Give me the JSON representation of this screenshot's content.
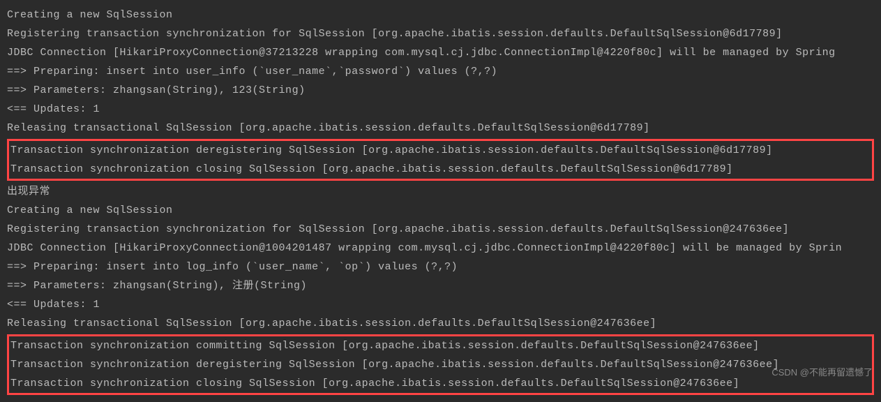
{
  "lines": {
    "l1": "Creating a new SqlSession",
    "l2": "Registering transaction synchronization for SqlSession [org.apache.ibatis.session.defaults.DefaultSqlSession@6d17789]",
    "l3": "JDBC Connection [HikariProxyConnection@37213228 wrapping com.mysql.cj.jdbc.ConnectionImpl@4220f80c] will be managed by Spring",
    "l4": "==>  Preparing: insert into user_info (`user_name`,`password`) values (?,?)",
    "l5": "==> Parameters: zhangsan(String), 123(String)",
    "l6": "<==    Updates: 1",
    "l7": "Releasing transactional SqlSession [org.apache.ibatis.session.defaults.DefaultSqlSession@6d17789]",
    "l8": "Transaction synchronization deregistering SqlSession [org.apache.ibatis.session.defaults.DefaultSqlSession@6d17789]",
    "l9": "Transaction synchronization closing SqlSession [org.apache.ibatis.session.defaults.DefaultSqlSession@6d17789]",
    "l10": "出现异常",
    "l11": "Creating a new SqlSession",
    "l12": "Registering transaction synchronization for SqlSession [org.apache.ibatis.session.defaults.DefaultSqlSession@247636ee]",
    "l13": "JDBC Connection [HikariProxyConnection@1004201487 wrapping com.mysql.cj.jdbc.ConnectionImpl@4220f80c] will be managed by Sprin",
    "l14": "==>  Preparing: insert into log_info (`user_name`, `op`) values (?,?)",
    "l15": "==> Parameters: zhangsan(String), 注册(String)",
    "l16": "<==    Updates: 1",
    "l17": "Releasing transactional SqlSession [org.apache.ibatis.session.defaults.DefaultSqlSession@247636ee]",
    "l18": "Transaction synchronization committing SqlSession [org.apache.ibatis.session.defaults.DefaultSqlSession@247636ee]",
    "l19": "Transaction synchronization deregistering SqlSession [org.apache.ibatis.session.defaults.DefaultSqlSession@247636ee]",
    "l20": "Transaction synchronization closing SqlSession [org.apache.ibatis.session.defaults.DefaultSqlSession@247636ee]"
  },
  "watermark": "CSDN @不能再留遗憾了"
}
